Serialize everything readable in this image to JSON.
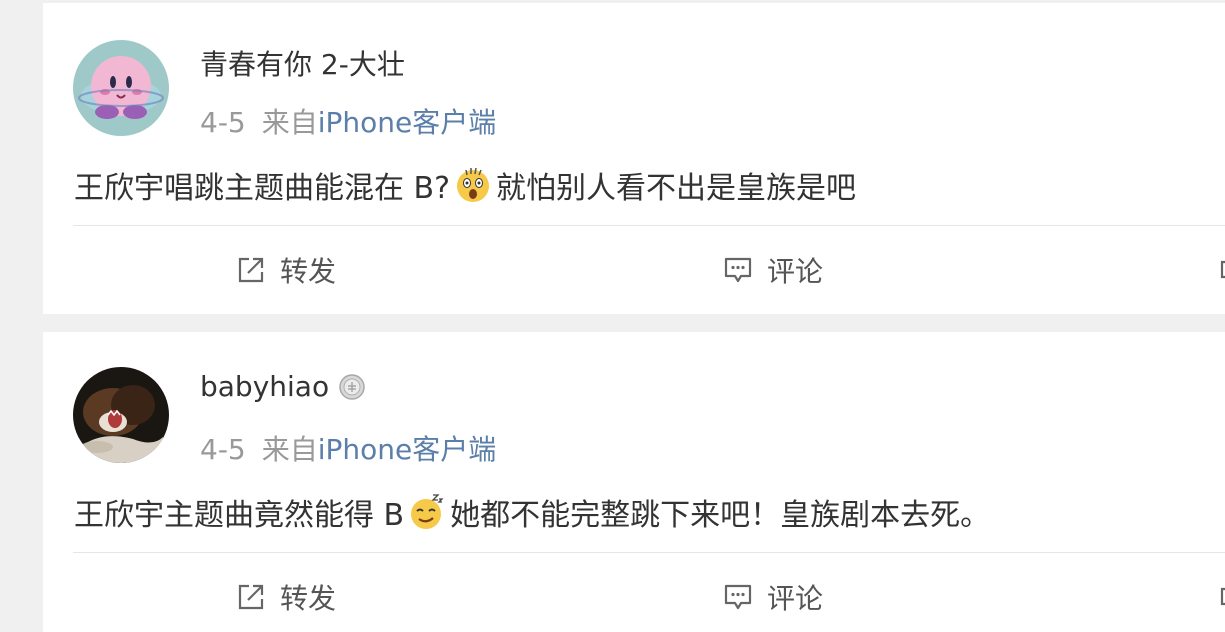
{
  "posts": [
    {
      "username": "青春有你 2-大壮",
      "date": "4-5",
      "from": "来自",
      "client": "iPhone客户端",
      "content_before": "王欣宇唱跳主题曲能混在 B?",
      "content_after": "就怕别人看不出是皇族是吧",
      "emoji": "shocked-emoji",
      "actions": {
        "repost": "转发",
        "comment": "评论"
      }
    },
    {
      "username": "babyhiao",
      "user_badge": "medal-badge-icon",
      "date": "4-5",
      "from": "来自",
      "client": "iPhone客户端",
      "content_before": "王欣宇主题曲竟然能得 B",
      "content_after": "她都不能完整跳下来吧！皇族剧本去死。",
      "emoji": "smug-emoji",
      "actions": {
        "repost": "转发",
        "comment": "评论"
      }
    }
  ],
  "colors": {
    "background": "#f0f0f0",
    "card": "#ffffff",
    "username": "#333333",
    "meta": "#999999",
    "client_link": "#5b7fa8",
    "action_text": "#555555"
  }
}
